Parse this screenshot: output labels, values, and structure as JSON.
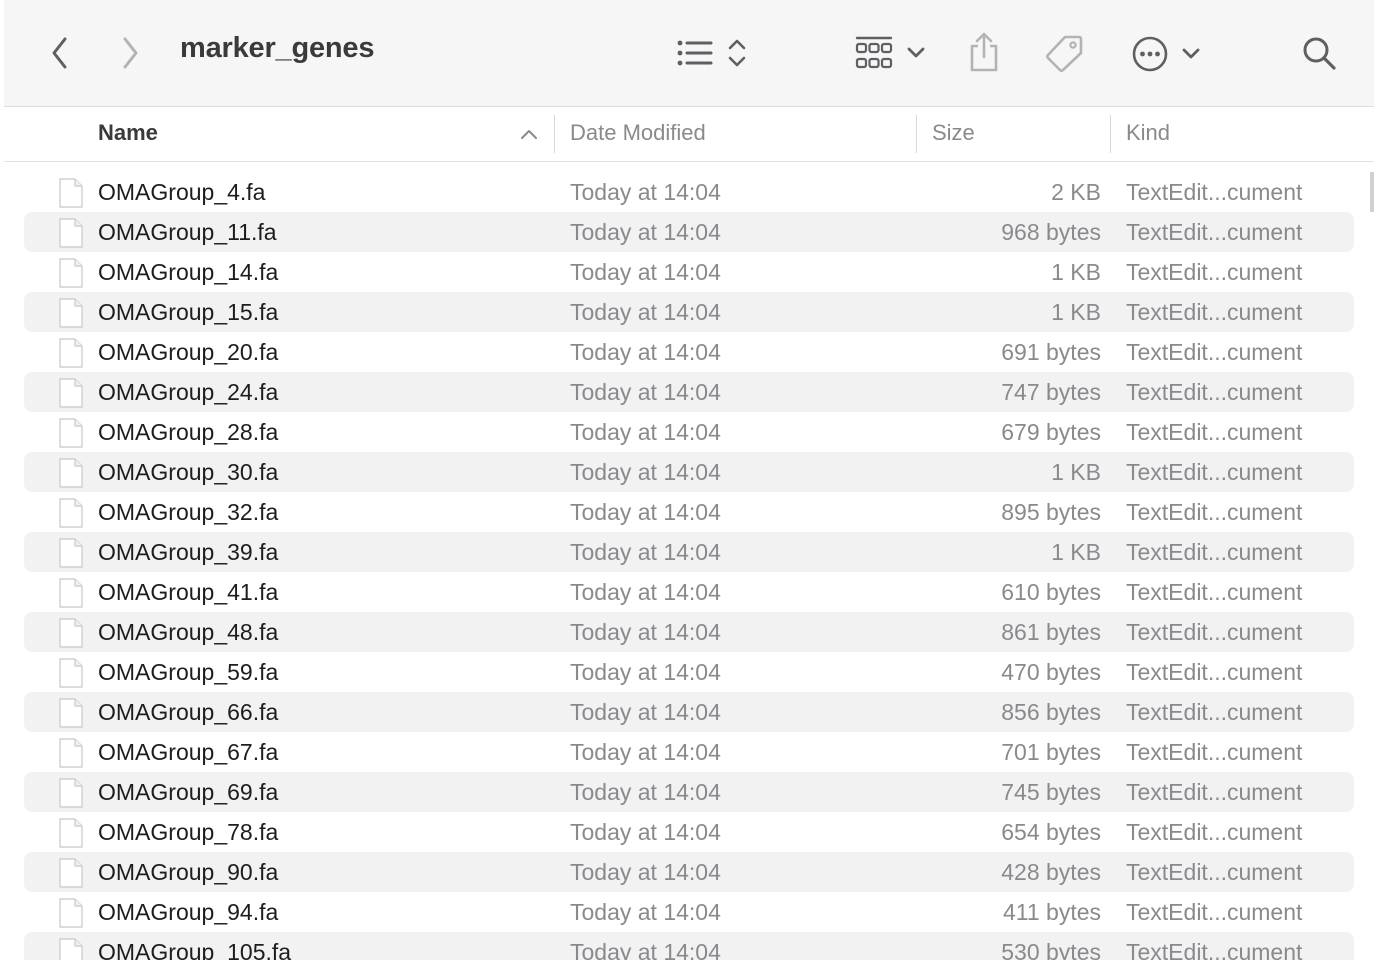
{
  "window": {
    "title": "marker_genes"
  },
  "toolbar": {
    "icons": [
      "chevron-left-icon",
      "chevron-right-icon",
      "list-view-icon",
      "sort-arrows-icon",
      "grid-group-icon",
      "chevron-down-icon",
      "share-icon",
      "tag-icon",
      "more-icon",
      "search-icon"
    ]
  },
  "columns": {
    "name": "Name",
    "date": "Date Modified",
    "size": "Size",
    "kind": "Kind",
    "sort_column": "name",
    "sort_direction": "ascending"
  },
  "files": [
    {
      "name": "OMAGroup_4.fa",
      "date": "Today at 14:04",
      "size": "2 KB",
      "kind": "TextEdit...cument"
    },
    {
      "name": "OMAGroup_11.fa",
      "date": "Today at 14:04",
      "size": "968 bytes",
      "kind": "TextEdit...cument"
    },
    {
      "name": "OMAGroup_14.fa",
      "date": "Today at 14:04",
      "size": "1 KB",
      "kind": "TextEdit...cument"
    },
    {
      "name": "OMAGroup_15.fa",
      "date": "Today at 14:04",
      "size": "1 KB",
      "kind": "TextEdit...cument"
    },
    {
      "name": "OMAGroup_20.fa",
      "date": "Today at 14:04",
      "size": "691 bytes",
      "kind": "TextEdit...cument"
    },
    {
      "name": "OMAGroup_24.fa",
      "date": "Today at 14:04",
      "size": "747 bytes",
      "kind": "TextEdit...cument"
    },
    {
      "name": "OMAGroup_28.fa",
      "date": "Today at 14:04",
      "size": "679 bytes",
      "kind": "TextEdit...cument"
    },
    {
      "name": "OMAGroup_30.fa",
      "date": "Today at 14:04",
      "size": "1 KB",
      "kind": "TextEdit...cument"
    },
    {
      "name": "OMAGroup_32.fa",
      "date": "Today at 14:04",
      "size": "895 bytes",
      "kind": "TextEdit...cument"
    },
    {
      "name": "OMAGroup_39.fa",
      "date": "Today at 14:04",
      "size": "1 KB",
      "kind": "TextEdit...cument"
    },
    {
      "name": "OMAGroup_41.fa",
      "date": "Today at 14:04",
      "size": "610 bytes",
      "kind": "TextEdit...cument"
    },
    {
      "name": "OMAGroup_48.fa",
      "date": "Today at 14:04",
      "size": "861 bytes",
      "kind": "TextEdit...cument"
    },
    {
      "name": "OMAGroup_59.fa",
      "date": "Today at 14:04",
      "size": "470 bytes",
      "kind": "TextEdit...cument"
    },
    {
      "name": "OMAGroup_66.fa",
      "date": "Today at 14:04",
      "size": "856 bytes",
      "kind": "TextEdit...cument"
    },
    {
      "name": "OMAGroup_67.fa",
      "date": "Today at 14:04",
      "size": "701 bytes",
      "kind": "TextEdit...cument"
    },
    {
      "name": "OMAGroup_69.fa",
      "date": "Today at 14:04",
      "size": "745 bytes",
      "kind": "TextEdit...cument"
    },
    {
      "name": "OMAGroup_78.fa",
      "date": "Today at 14:04",
      "size": "654 bytes",
      "kind": "TextEdit...cument"
    },
    {
      "name": "OMAGroup_90.fa",
      "date": "Today at 14:04",
      "size": "428 bytes",
      "kind": "TextEdit...cument"
    },
    {
      "name": "OMAGroup_94.fa",
      "date": "Today at 14:04",
      "size": "411 bytes",
      "kind": "TextEdit...cument"
    },
    {
      "name": "OMAGroup_105.fa",
      "date": "Today at 14:04",
      "size": "530 bytes",
      "kind": "TextEdit...cument"
    }
  ],
  "colors": {
    "toolbar_bg": "#f6f6f6",
    "row_alt": "#f2f2f3",
    "secondary_text": "#8a8a8e",
    "primary_text": "#1d1d1f"
  }
}
